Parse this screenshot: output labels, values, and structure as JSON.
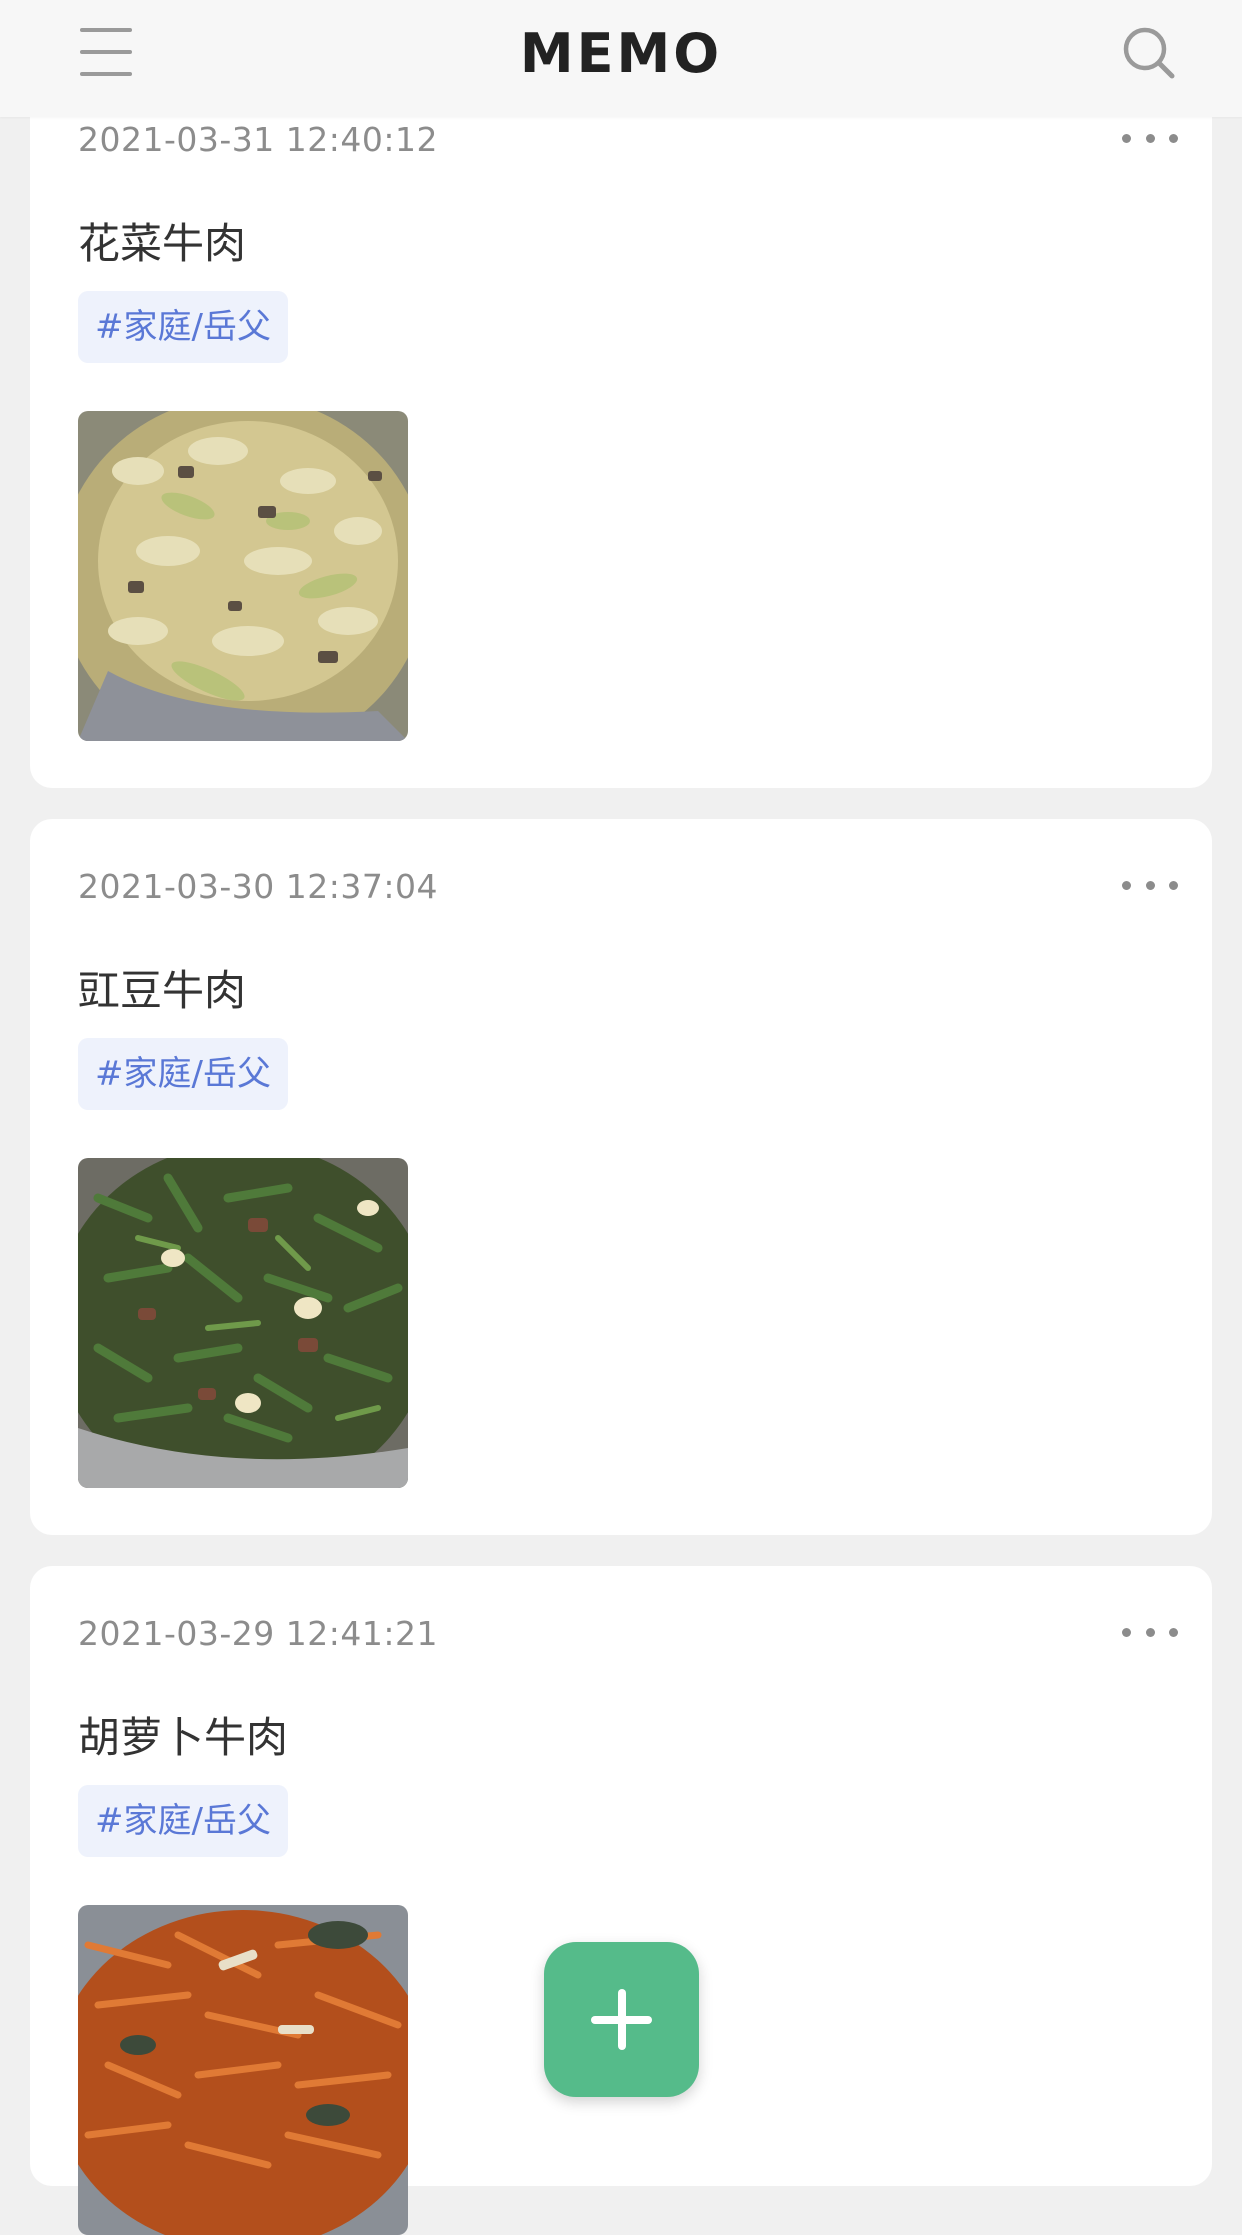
{
  "header": {
    "title": "MEMO",
    "menu_icon": "menu-icon",
    "search_icon": "search-icon"
  },
  "memos": [
    {
      "time": "2021-03-31 12:40:12",
      "text": "花菜牛肉",
      "tag": "#家庭/岳父",
      "image": "cauliflower-beef-photo",
      "more_icon": "more-icon"
    },
    {
      "time": "2021-03-30 12:37:04",
      "text": "豇豆牛肉",
      "tag": "#家庭/岳父",
      "image": "long-bean-beef-photo",
      "more_icon": "more-icon"
    },
    {
      "time": "2021-03-29 12:41:21",
      "text": "胡萝卜牛肉",
      "tag": "#家庭/岳父",
      "image": "carrot-beef-photo",
      "more_icon": "more-icon"
    }
  ],
  "fab": {
    "icon": "plus-icon"
  },
  "colors": {
    "accent": "#55bb8a",
    "tag_text": "#5a78d6",
    "tag_bg": "#eef2fc",
    "page_bg": "#f0f0f0"
  }
}
